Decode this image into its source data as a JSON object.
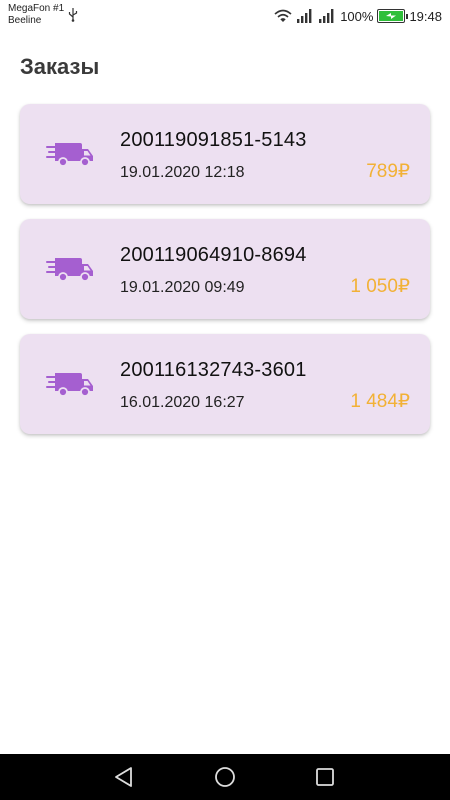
{
  "status_bar": {
    "carrier_1": "MegaFon #1",
    "carrier_2": "Beeline",
    "battery": "100%",
    "time": "19:48",
    "icons": [
      "usb-icon",
      "wifi-icon",
      "signal-icon",
      "signal-icon",
      "battery-charging-icon"
    ]
  },
  "page": {
    "title": "Заказы"
  },
  "orders": [
    {
      "id": "200119091851-5143",
      "date": "19.01.2020 12:18",
      "price": "789₽",
      "icon": "delivery-truck-icon"
    },
    {
      "id": "200119064910-8694",
      "date": "19.01.2020 09:49",
      "price": "1 050₽",
      "icon": "delivery-truck-icon"
    },
    {
      "id": "200116132743-3601",
      "date": "16.01.2020 16:27",
      "price": "1 484₽",
      "icon": "delivery-truck-icon"
    }
  ],
  "colors": {
    "card_bg": "#ede0f1",
    "price": "#f2b136",
    "truck": "#a55fd0"
  },
  "nav_bar": {
    "buttons": [
      "back-icon",
      "home-icon",
      "recents-icon"
    ]
  }
}
